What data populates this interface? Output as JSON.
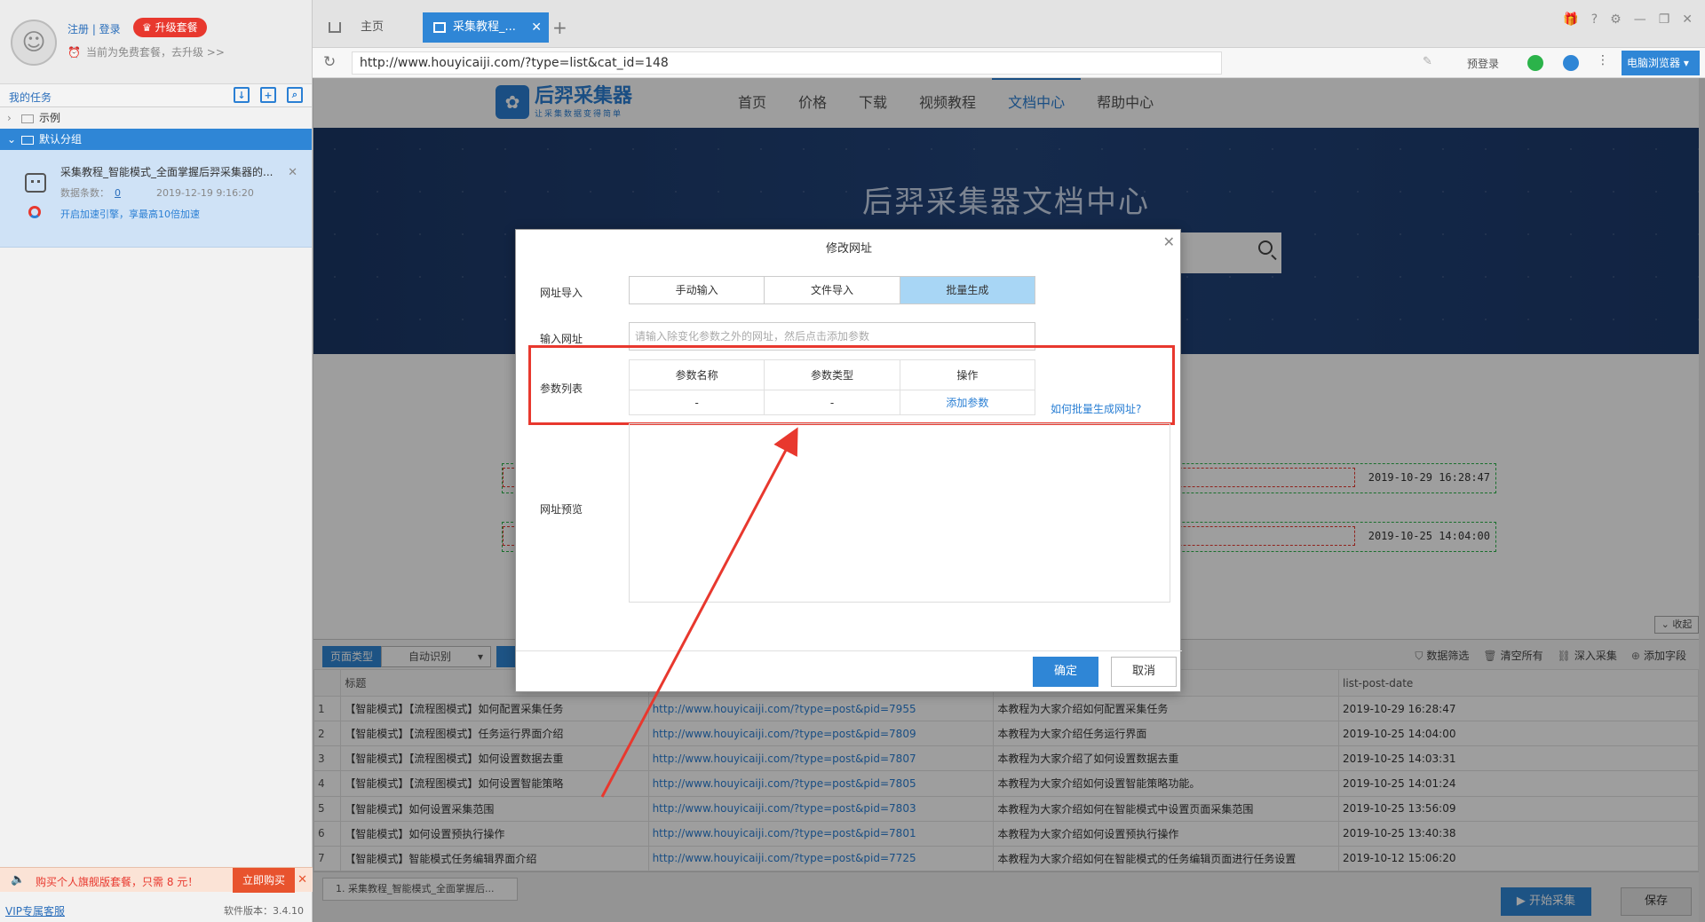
{
  "user": {
    "login_link": "注册 | 登录",
    "upgrade_label": "♛ 升级套餐",
    "plan_text": "当前为免费套餐，去升级 >>"
  },
  "tasks": {
    "header": "我的任务",
    "groups": [
      {
        "name": "示例",
        "selected": false
      },
      {
        "name": "默认分组",
        "selected": true
      }
    ],
    "card": {
      "title": "采集教程_智能模式_全面掌握后羿采集器的...",
      "count_label": "数据条数：",
      "count": "0",
      "datetime": "2019-12-19 9:16:20",
      "speed_text": "开启加速引擎，享最高10倍加速"
    }
  },
  "promo": {
    "text": "购买个人旗舰版套餐，只需 8 元！",
    "buy_label": "立即购买"
  },
  "footer_left": {
    "vip_link": "VIP专属客服",
    "version": "软件版本：3.4.10"
  },
  "browser": {
    "tabs": [
      {
        "label": "主页",
        "active": false
      },
      {
        "label": "采集教程_...",
        "active": true
      }
    ],
    "url": "http://www.houyicaiji.com/?type=list&cat_id=148",
    "pre_login": "预登录",
    "browser_button": "电脑浏览器"
  },
  "site": {
    "logo_name": "后羿采集器",
    "logo_slogan": "让采集数据变得简单",
    "menu": [
      {
        "label": "首页",
        "active": false
      },
      {
        "label": "价格",
        "active": false
      },
      {
        "label": "下载",
        "active": false
      },
      {
        "label": "视频教程",
        "active": false
      },
      {
        "label": "文档中心",
        "active": true
      },
      {
        "label": "帮助中心",
        "active": false
      }
    ],
    "hero_title": "后羿采集器文档中心",
    "doc_dates": [
      "2019-10-29 16:28:47",
      "2019-10-25 14:04:00"
    ],
    "collapse_label": "收起"
  },
  "data_panel": {
    "page_type_label": "页面类型",
    "page_type_value": "自动识别",
    "tools": [
      {
        "icon": "filter-icon",
        "label": "数据筛选"
      },
      {
        "icon": "trash-icon",
        "label": "清空所有"
      },
      {
        "icon": "link-icon",
        "label": "深入采集"
      },
      {
        "icon": "plus-circle-icon",
        "label": "添加字段"
      }
    ],
    "columns": [
      "",
      "标题",
      "",
      "",
      "list-post-date"
    ],
    "rows": [
      [
        "1",
        "【智能模式】【流程图模式】如何配置采集任务",
        "http://www.houyicaiji.com/?type=post&pid=7955",
        "本教程为大家介绍如何配置采集任务",
        "2019-10-29 16:28:47"
      ],
      [
        "2",
        "【智能模式】【流程图模式】任务运行界面介绍",
        "http://www.houyicaiji.com/?type=post&pid=7809",
        "本教程为大家介绍任务运行界面",
        "2019-10-25 14:04:00"
      ],
      [
        "3",
        "【智能模式】【流程图模式】如何设置数据去重",
        "http://www.houyicaiji.com/?type=post&pid=7807",
        "本教程为大家介绍了如何设置数据去重",
        "2019-10-25 14:03:31"
      ],
      [
        "4",
        "【智能模式】【流程图模式】如何设置智能策略",
        "http://www.houyicaiji.com/?type=post&pid=7805",
        "本教程为大家介绍如何设置智能策略功能。",
        "2019-10-25 14:01:24"
      ],
      [
        "5",
        "【智能模式】如何设置采集范围",
        "http://www.houyicaiji.com/?type=post&pid=7803",
        "本教程为大家介绍如何在智能模式中设置页面采集范围",
        "2019-10-25 13:56:09"
      ],
      [
        "6",
        "【智能模式】如何设置预执行操作",
        "http://www.houyicaiji.com/?type=post&pid=7801",
        "本教程为大家介绍如何设置预执行操作",
        "2019-10-25 13:40:38"
      ],
      [
        "7",
        "【智能模式】智能模式任务编辑界面介绍",
        "http://www.houyicaiji.com/?type=post&pid=7725",
        "本教程为大家介绍如何在智能模式的任务编辑页面进行任务设置",
        "2019-10-12 15:06:20"
      ]
    ],
    "task_tab": "1. 采集教程_智能模式_全面掌握后...",
    "start_label": "▶ 开始采集",
    "save_label": "保存"
  },
  "dialog": {
    "title": "修改网址",
    "label_import": "网址导入",
    "import_modes": [
      {
        "label": "手动输入",
        "active": false
      },
      {
        "label": "文件导入",
        "active": false
      },
      {
        "label": "批量生成",
        "active": true
      }
    ],
    "label_input": "输入网址",
    "input_placeholder": "请输入除变化参数之外的网址，然后点击添加参数",
    "label_params": "参数列表",
    "param_headers": [
      "参数名称",
      "参数类型",
      "操作"
    ],
    "param_row": [
      "-",
      "-",
      "添加参数"
    ],
    "how_link": "如何批量生成网址?",
    "label_preview": "网址预览",
    "ok_label": "确定",
    "cancel_label": "取消"
  },
  "colors": {
    "accent": "#2f86d6",
    "highlight_box": "#e8382e",
    "active_segment": "#a8d6f5"
  }
}
